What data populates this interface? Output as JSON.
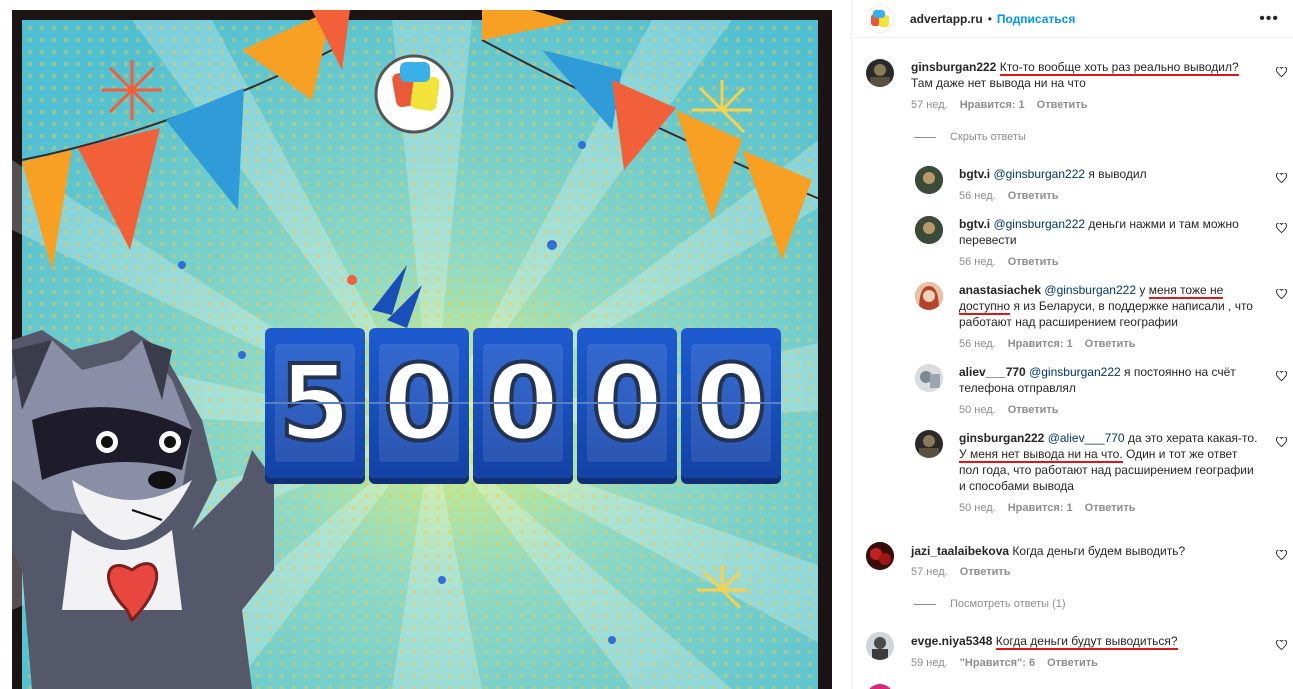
{
  "header": {
    "username": "advertapp.ru",
    "dot": "•",
    "follow_label": "Подписаться",
    "more_icon": "more-horizontal-icon"
  },
  "post_image": {
    "counter_digits": [
      "5",
      "0",
      "0",
      "0",
      "0"
    ],
    "colors": {
      "background": "#58c6d7",
      "card": "#1d5bd0"
    }
  },
  "comments": [
    {
      "username": "ginsburgan222",
      "text_underlined": "Кто-то вообще хоть раз реально выводил?",
      "text_rest": "Там даже нет вывода ни на что",
      "age": "57 нед.",
      "likes": "Нравится: 1",
      "reply": "Ответить",
      "toggle": "Скрыть ответы"
    },
    {
      "username": "bgtv.i",
      "mention": "@ginsburgan222",
      "text": "я выводил",
      "age": "56 нед.",
      "reply": "Ответить"
    },
    {
      "username": "bgtv.i",
      "mention": "@ginsburgan222",
      "text": "деньги нажми и там можно перевести",
      "age": "56 нед.",
      "reply": "Ответить"
    },
    {
      "username": "anastasiachek",
      "mention": "@ginsburgan222",
      "text_pre": "у",
      "text_underlined": "меня тоже не доступно",
      "text_rest": "я из Беларуси, в поддержке написали , что работают над расширением географии",
      "age": "56 нед.",
      "likes": "Нравится: 1",
      "reply": "Ответить"
    },
    {
      "username": "aliev___770",
      "mention": "@ginsburgan222",
      "text": "я постоянно на счёт телефона отправлял",
      "age": "50 нед.",
      "reply": "Ответить"
    },
    {
      "username": "ginsburgan222",
      "mention": "@aliev___770",
      "text_pre": "да это херата какая-то.",
      "text_underlined": "У меня нет вывода ни на что.",
      "text_rest": "Один и тот же ответ пол года, что работают над расширением географии и способами вывода",
      "age": "50 нед.",
      "likes": "Нравится: 1",
      "reply": "Ответить"
    },
    {
      "username": "jazi_taalaibekova",
      "text": "Когда деньги будем выводить?",
      "age": "57 нед.",
      "reply": "Ответить",
      "toggle": "Посмотреть ответы (1)"
    },
    {
      "username": "evge.niya5348",
      "text_underlined": "Когда деньги будут выводиться?",
      "age": "59 нед.",
      "likes": "\"Нравится\": 6",
      "reply": "Ответить"
    }
  ]
}
